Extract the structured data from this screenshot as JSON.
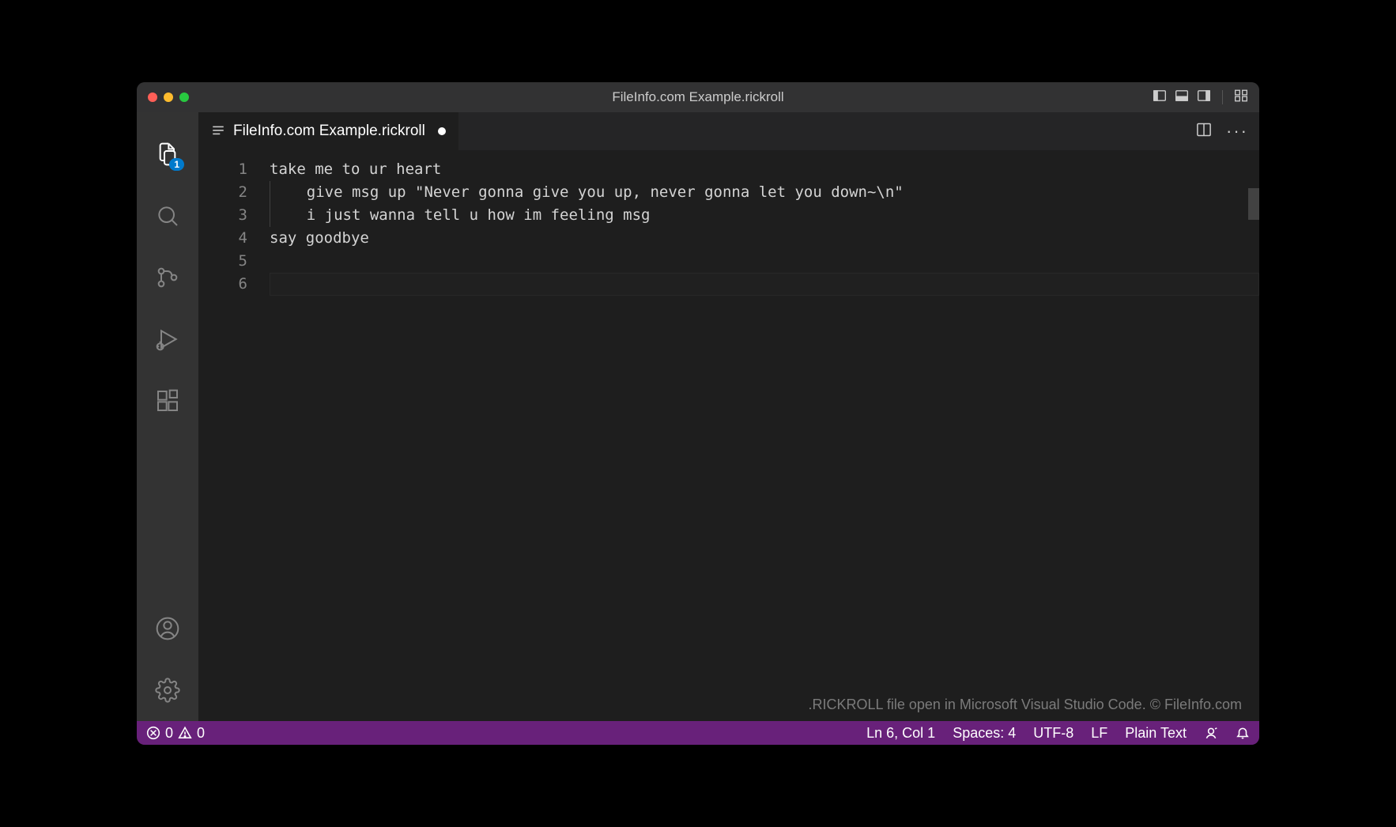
{
  "window": {
    "title": "FileInfo.com Example.rickroll"
  },
  "activityBar": {
    "explorerBadge": "1"
  },
  "tabs": [
    {
      "label": "FileInfo.com Example.rickroll",
      "dirty": true
    }
  ],
  "editor": {
    "lineNumbers": [
      "1",
      "2",
      "3",
      "4",
      "5",
      "6"
    ],
    "lines": [
      {
        "indentGuide": false,
        "text": "take me to ur heart"
      },
      {
        "indentGuide": true,
        "text": "give msg up \"Never gonna give you up, never gonna let you down~\\n\""
      },
      {
        "indentGuide": true,
        "text": "i just wanna tell u how im feeling msg"
      },
      {
        "indentGuide": false,
        "text": "say goodbye"
      },
      {
        "indentGuide": false,
        "text": ""
      },
      {
        "indentGuide": false,
        "text": ""
      }
    ],
    "activeLineIndex": 5
  },
  "watermark": ".RICKROLL file open in Microsoft Visual Studio Code. © FileInfo.com",
  "statusBar": {
    "errors": "0",
    "warnings": "0",
    "cursor": "Ln 6, Col 1",
    "indent": "Spaces: 4",
    "encoding": "UTF-8",
    "eol": "LF",
    "language": "Plain Text"
  }
}
